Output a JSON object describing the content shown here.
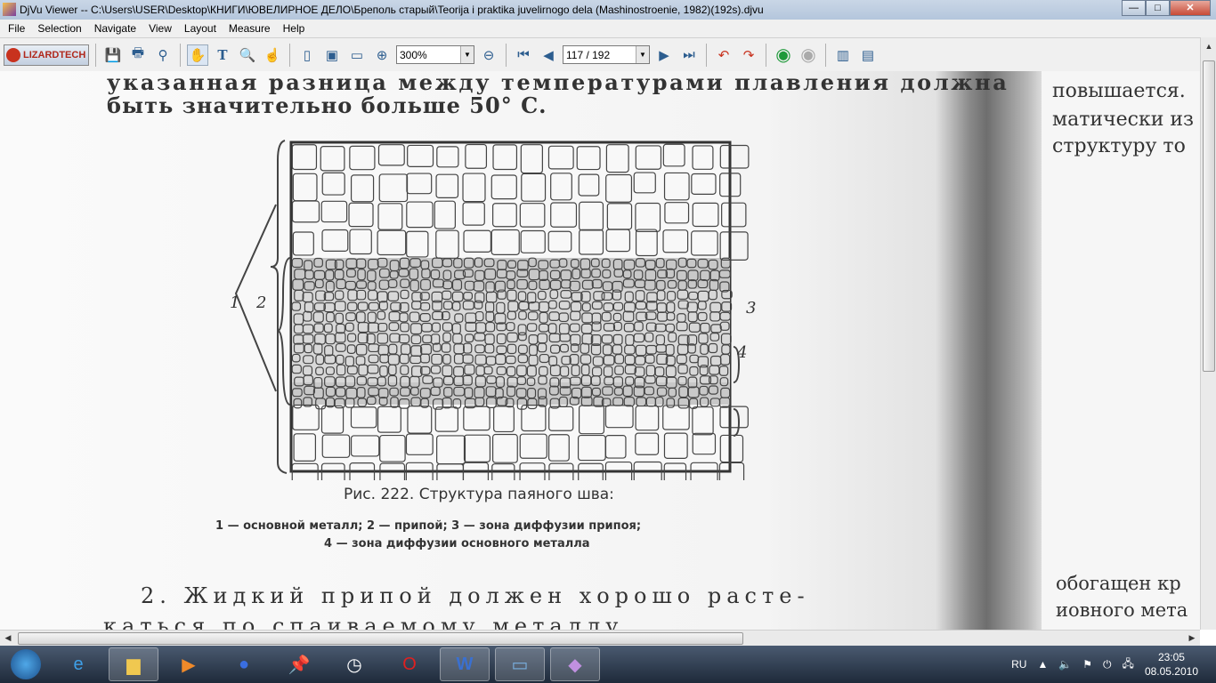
{
  "window": {
    "title": "DjVu Viewer -- C:\\Users\\USER\\Desktop\\КНИГИ\\ЮВЕЛИРНОЕ ДЕЛО\\Бреполь старый\\Teorija i praktika juvelirnogo dela (Mashinostroenie, 1982)(192s).djvu",
    "minimize": "—",
    "maximize": "□",
    "close": "✕"
  },
  "menu": [
    "File",
    "Selection",
    "Navigate",
    "View",
    "Layout",
    "Measure",
    "Help"
  ],
  "toolbar": {
    "logo": "LIZARDTECH",
    "zoom": "300%",
    "page": "117 / 192"
  },
  "document": {
    "left_lines": [
      "указанная разница между температурами плавления должна",
      "быть значительно больше 50° С."
    ],
    "figure_labels": [
      "1",
      "2",
      "3",
      "4"
    ],
    "caption": "Рис. 222. Структура паяного шва:",
    "legend1": "1 — основной металл;  2 — припой;  3 — зона диффузии припоя;",
    "legend2": "4 — зона диффузии основного металла",
    "para1": "2. Жидкий припой должен хорошо расте-",
    "para2": "каться по спаиваемому металлу.",
    "right_lines": [
      "повышается.",
      "матически из",
      "структуру то"
    ],
    "right_bottom": [
      "обогащен кр",
      "иовного мета"
    ]
  },
  "tray": {
    "lang": "RU",
    "time": "23:05",
    "date": "08.05.2010"
  }
}
